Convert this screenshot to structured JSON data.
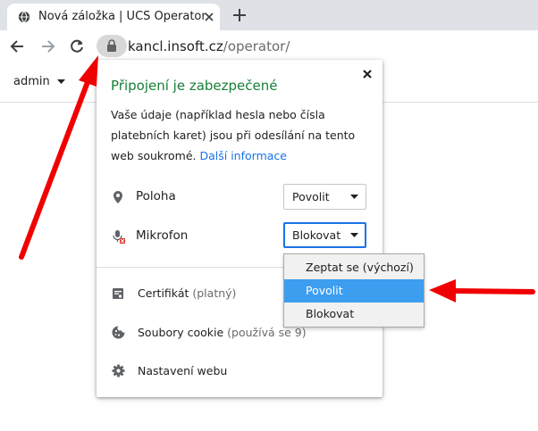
{
  "tab": {
    "title": "Nová záložka | UCS Operator",
    "favicon": "globe-icon",
    "close": "close-icon"
  },
  "toolbar": {
    "back": "back-arrow-icon",
    "forward": "forward-arrow-icon",
    "reload": "reload-icon",
    "new_tab": "plus-icon"
  },
  "address": {
    "host": "kancl.insoft.cz",
    "path": "/operator/",
    "lock": "lock-icon"
  },
  "page": {
    "user_menu": "admin"
  },
  "site_info": {
    "heading": "Připojení je zabezpečené",
    "description": "Vaše údaje (například hesla nebo čísla platebních karet) jsou při odesílání na tento web soukromé.",
    "more_info": "Další informace",
    "permissions": [
      {
        "label": "Poloha",
        "icon": "location-pin-icon",
        "value": "Povolit"
      },
      {
        "label": "Mikrofon",
        "icon": "microphone-blocked-icon",
        "value": "Blokovat"
      }
    ],
    "items": [
      {
        "label": "Certifikát",
        "sub": "(platný)",
        "icon": "certificate-icon"
      },
      {
        "label": "Soubory cookie",
        "sub": "(používá se 9)",
        "icon": "cookie-icon"
      },
      {
        "label": "Nastavení webu",
        "sub": "",
        "icon": "gear-icon"
      }
    ]
  },
  "dropdown": {
    "options": [
      "Zeptat se (výchozí)",
      "Povolit",
      "Blokovat"
    ],
    "highlighted": "Povolit"
  },
  "colors": {
    "secure_green": "#188038",
    "link_blue": "#1a73e8",
    "highlight": "#3d9ef0",
    "arrow_red": "#f00000"
  }
}
